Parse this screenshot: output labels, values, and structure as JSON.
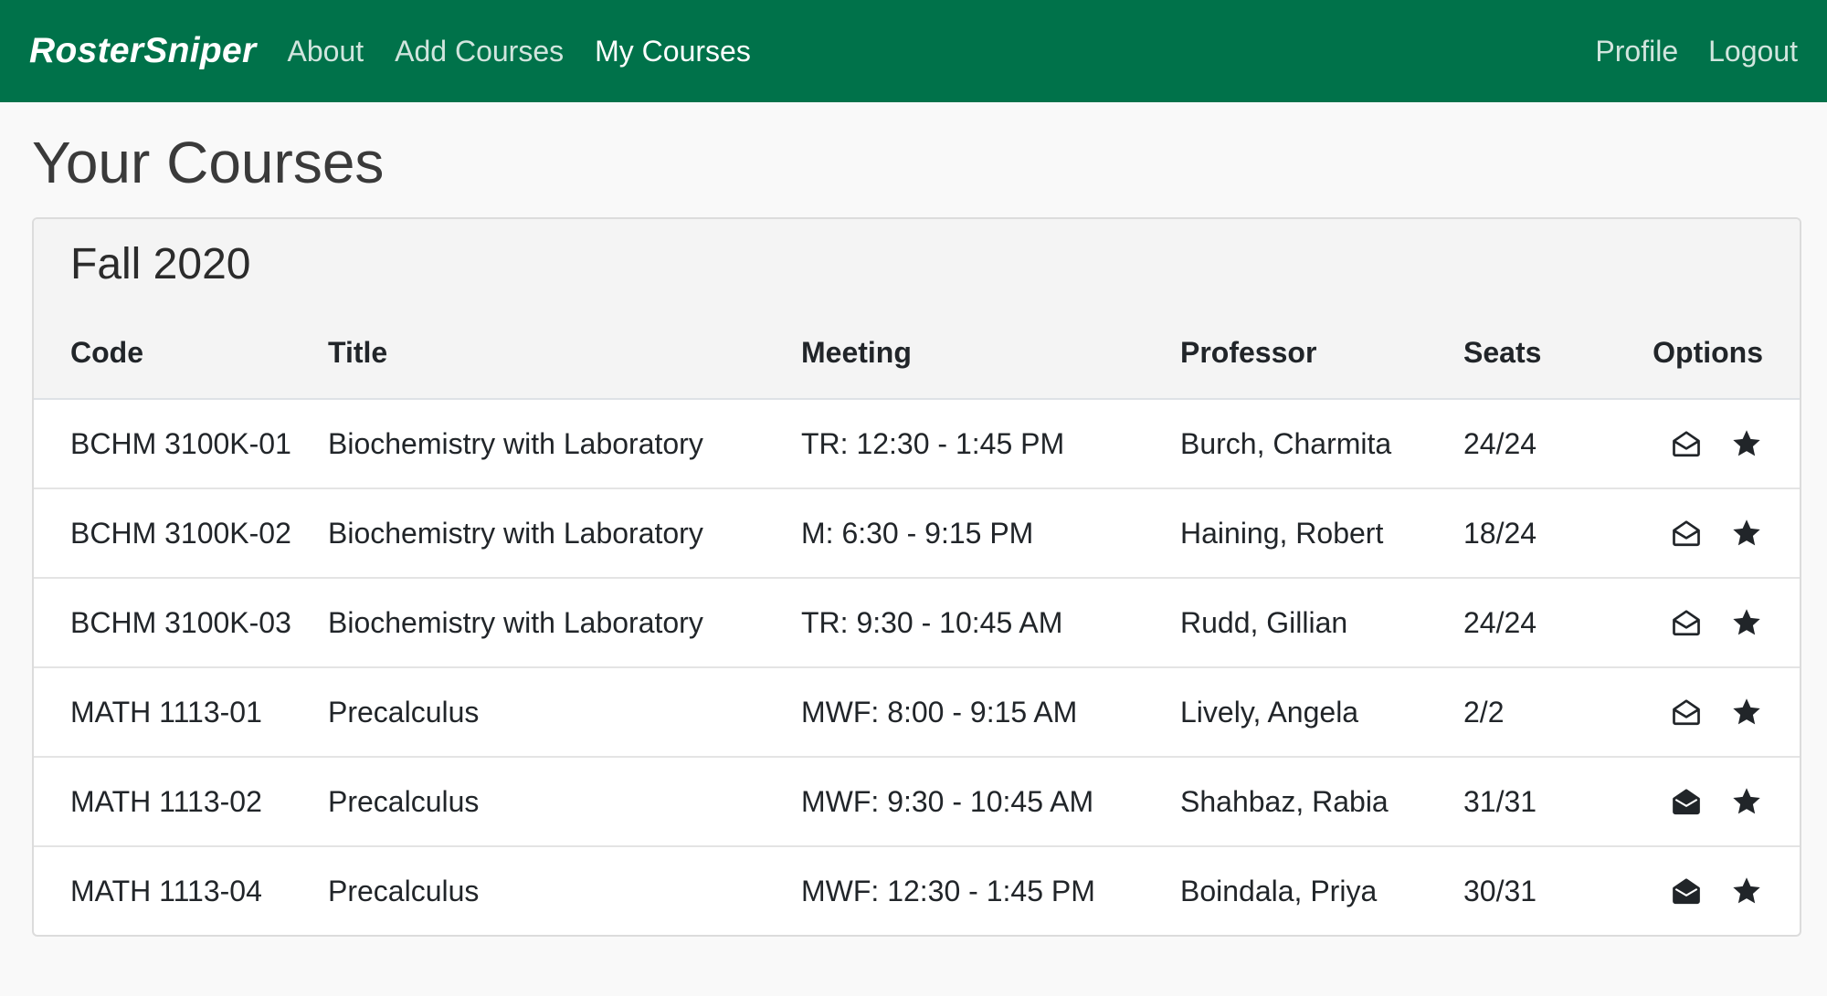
{
  "nav": {
    "brand": "RosterSniper",
    "links": [
      "About",
      "Add Courses",
      "My Courses"
    ],
    "right_links": [
      "Profile",
      "Logout"
    ],
    "active": "My Courses"
  },
  "page_title": "Your Courses",
  "term": "Fall 2020",
  "table": {
    "headers": [
      "Code",
      "Title",
      "Meeting",
      "Professor",
      "Seats",
      "Options"
    ],
    "rows": [
      {
        "code": "BCHM 3100K-01",
        "title": "Biochemistry with Laboratory",
        "meeting": "TR: 12:30 - 1:45 PM",
        "professor": "Burch, Charmita",
        "seats": "24/24",
        "notify": "envelope-open-outline-icon",
        "favorite": "star-icon"
      },
      {
        "code": "BCHM 3100K-02",
        "title": "Biochemistry with Laboratory",
        "meeting": "M: 6:30 - 9:15 PM",
        "professor": "Haining, Robert",
        "seats": "18/24",
        "notify": "envelope-open-outline-icon",
        "favorite": "star-icon"
      },
      {
        "code": "BCHM 3100K-03",
        "title": "Biochemistry with Laboratory",
        "meeting": "TR: 9:30 - 10:45 AM",
        "professor": "Rudd, Gillian",
        "seats": "24/24",
        "notify": "envelope-open-outline-icon",
        "favorite": "star-icon"
      },
      {
        "code": "MATH 1113-01",
        "title": "Precalculus",
        "meeting": "MWF: 8:00 - 9:15 AM",
        "professor": "Lively, Angela",
        "seats": "2/2",
        "notify": "envelope-open-outline-icon",
        "favorite": "star-icon"
      },
      {
        "code": "MATH 1113-02",
        "title": "Precalculus",
        "meeting": "MWF: 9:30 - 10:45 AM",
        "professor": "Shahbaz, Rabia",
        "seats": "31/31",
        "notify": "envelope-open-filled-icon",
        "favorite": "star-icon"
      },
      {
        "code": "MATH 1113-04",
        "title": "Precalculus",
        "meeting": "MWF: 12:30 - 1:45 PM",
        "professor": "Boindala, Priya",
        "seats": "30/31",
        "notify": "envelope-open-filled-icon",
        "favorite": "star-icon"
      }
    ]
  },
  "colors": {
    "navbar": "#00724a",
    "background": "#f9f9f9",
    "card_header": "#f4f4f4"
  }
}
